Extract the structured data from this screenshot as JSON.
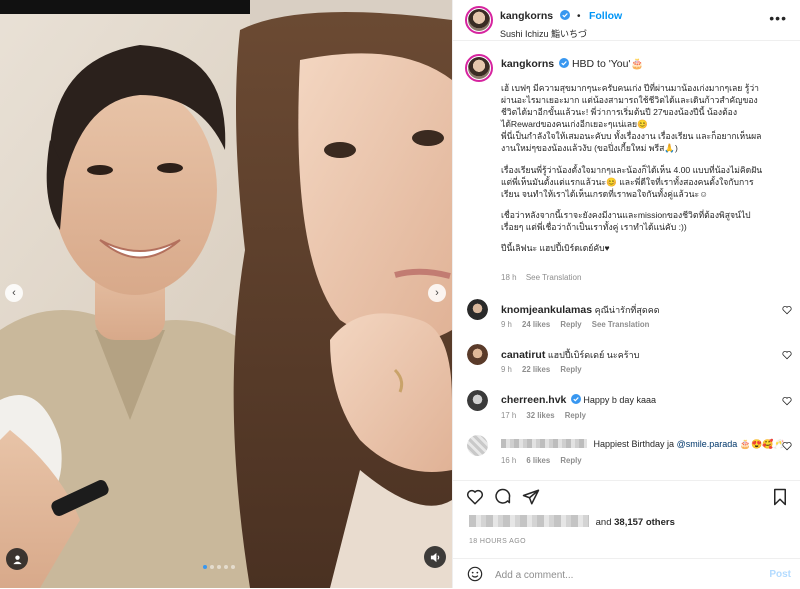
{
  "post": {
    "username": "kangkorns",
    "follow_label": "Follow",
    "separator": "•",
    "location": "Sushi Ichizu 鮨いちづ",
    "more_label": "•••"
  },
  "caption": {
    "username": "kangkorns",
    "headline": "HBD to 'You'🎂",
    "paragraphs": [
      "เฮ้ เบฟๆ มีความสุขมากๆนะครับคนเก่ง ปีที่ผ่านมาน้องเก่งมากๆเลย รู้ว่าผ่านอะไรมาเยอะมาก แต่น้องสามารถใช้ชีวิตได้และเดินก้าวสำคัญของชีวิตได้มาอีกขั้นแล้วนะ! พี่ว่าการเริ่มต้นปี 27ของน้องปีนี้ น้องต้องได้Rewardของคนเก่งอีกเยอะๆแน่เลย😊\nพี่นี่เป็นกำลังใจให้เสมอนะคับบ ทั้งเรื่องงาน เรื่องเรียน และก็อยากเห็นผลงานใหม่ๆของน้องแล้วงับ (ขอปิ่งเกี้ยใหม่ พรีส🙏)",
      "เรื่องเรียนพี่รู้ว่าน้องตั้งใจมากๆและน้องก็ได้เห็น 4.00 แบบที่น้องไม่คิดฝัน แต่พี่เห็นมันตั้งแต่แรกแล้วนะ😊 และพี่ดีใจที่เราทั้งสองคนตั้งใจกับการเรียน จนทำให้เราได้เห็นเกรดที่เราพอใจกันทั้งคู่แล้วนะ☺",
      "เชื่อว่าหลังจากนี้เราจะยังคงมีงานและmissionของชีวิตที่ต้องพิสูจน์ไปเรื่อยๆ แต่พี่เชื่อว่าถ้าเป็นเราทั้งคู่ เราทำได้แน่คับ :))",
      "ปีนี้เลิฟนะ แฮปปี้เบิร์ดเดย์คับ♥"
    ],
    "time": "18 h",
    "see_translation": "See Translation"
  },
  "comments": [
    {
      "username": "knomjeankulamas",
      "text": "คุณีน่ารักที่สุดคด",
      "time": "9 h",
      "likes": "24 likes",
      "reply": "Reply",
      "translation": "See Translation"
    },
    {
      "username": "canatirut",
      "text": "แฮปปี้เบิร์ดเดย์ นะคร้าบ",
      "time": "9 h",
      "likes": "22 likes",
      "reply": "Reply"
    },
    {
      "username": "cherreen.hvk",
      "text": "Happy b day kaaa",
      "time": "17 h",
      "likes": "32 likes",
      "reply": "Reply"
    },
    {
      "username": "",
      "text": "Happiest Birthday ja",
      "mention": "@smile.parada",
      "emojis": "🎂😍🥰🥂",
      "time": "16 h",
      "likes": "6 likes",
      "reply": "Reply"
    }
  ],
  "likes": {
    "and_text": "and",
    "count": "38,157 others"
  },
  "time_ago": "18 HOURS AGO",
  "add_comment": {
    "placeholder": "Add a comment...",
    "post_label": "Post"
  },
  "colors": {
    "accent": "#0095f6",
    "muted": "#8e8e8e",
    "text": "#262626",
    "story_ring": "#d6249f"
  },
  "icons": [
    "verified-badge-icon",
    "heart-icon",
    "comment-icon",
    "share-icon",
    "bookmark-icon",
    "emoji-icon",
    "chevron-left-icon",
    "chevron-right-icon",
    "user-tag-icon",
    "mute-icon"
  ]
}
